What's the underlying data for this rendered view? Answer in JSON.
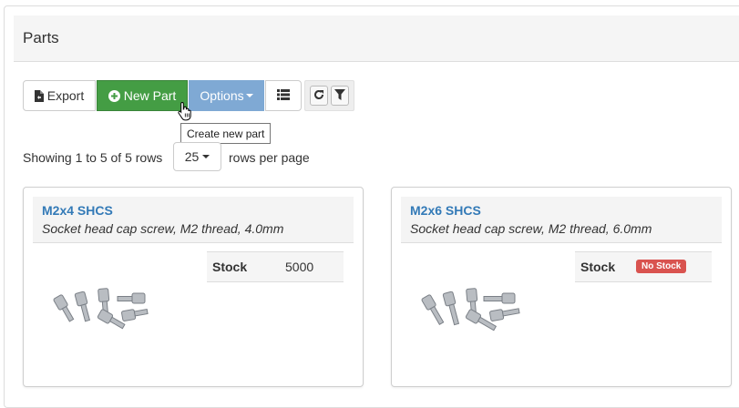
{
  "panel": {
    "title": "Parts"
  },
  "toolbar": {
    "export_label": "Export",
    "new_part_label": "New Part",
    "options_label": "Options",
    "tooltip": "Create new part"
  },
  "pagination": {
    "showing": "Showing 1 to 5 of 5 rows",
    "page_size": "25",
    "rows_per_page": "rows per page"
  },
  "parts": [
    {
      "name": "M2x4 SHCS",
      "description": "Socket head cap screw, M2 thread, 4.0mm",
      "stock_label": "Stock",
      "stock": "5000"
    },
    {
      "name": "M2x6 SHCS",
      "description": "Socket head cap screw, M2 thread, 6.0mm",
      "stock_label": "Stock",
      "stock_badge": "No Stock"
    }
  ],
  "colors": {
    "success": "#449d44",
    "primary_muted": "#7fa9d4",
    "danger": "#d9534f",
    "link": "#337ab7"
  },
  "icons": [
    "file-export-icon",
    "plus-circle-icon",
    "list-view-icon",
    "refresh-icon",
    "filter-icon",
    "hand-cursor-icon",
    "screw-image"
  ]
}
